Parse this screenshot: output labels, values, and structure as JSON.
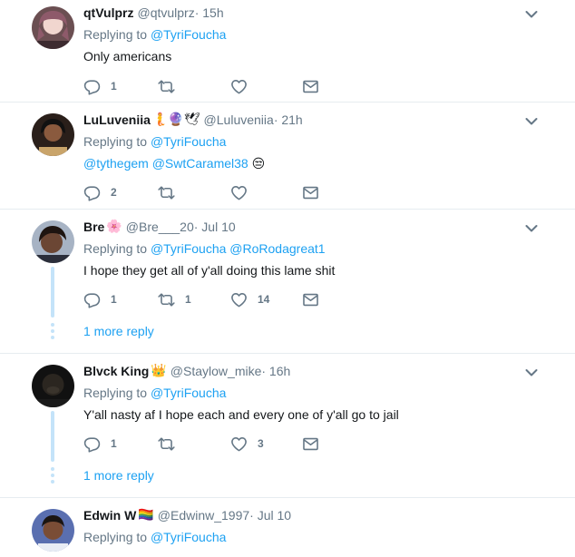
{
  "tweets": [
    {
      "name": "qtVulprz",
      "handle": "@qtvulprz",
      "time": " · 15h",
      "replying_label": "Replying to",
      "replying_to": "@TyriFoucha",
      "text": "Only americans",
      "replies": "1",
      "retweets": "",
      "likes": ""
    },
    {
      "name": "LuLuveniia",
      "name_emojis": "🧜🔮🕊",
      "handle": "@Luluveniia",
      "time": " · 21h",
      "replying_label": "Replying to",
      "replying_to": "@TyriFoucha",
      "text_mentions": "@tythegem @SwtCaramel38",
      "text_emoji": "😒",
      "replies": "2",
      "retweets": "",
      "likes": ""
    },
    {
      "name": "Bre",
      "name_emojis": "🌸",
      "handle": "@Bre___20",
      "time": " · Jul 10",
      "replying_label": "Replying to",
      "replying_to": "@TyriFoucha @RoRodagreat1",
      "text": "I hope they get all of y'all doing this lame shit",
      "replies": "1",
      "retweets": "1",
      "likes": "14",
      "more_reply": "1 more reply"
    },
    {
      "name": "Blvck King",
      "name_emojis": "👑",
      "handle": "@Staylow_mike",
      "time": " · 16h",
      "replying_label": "Replying to",
      "replying_to": "@TyriFoucha",
      "text": "Y'all nasty af I hope each and every one of y'all go to jail",
      "replies": "1",
      "retweets": "",
      "likes": "3",
      "more_reply": "1 more reply"
    },
    {
      "name": "Edwin W",
      "name_emojis": "🏳️‍🌈",
      "handle": "@Edwinw_1997",
      "time": " · Jul 10",
      "replying_label": "Replying to",
      "replying_to": "@TyriFoucha"
    }
  ],
  "icons": {
    "reply": "reply-icon",
    "retweet": "retweet-icon",
    "like": "heart-icon",
    "dm": "envelope-icon",
    "menu": "chevron-down-icon"
  },
  "colors": {
    "link": "#1da1f2",
    "secondary": "#657786",
    "divider": "#e6ecf0",
    "thread": "#c4e3f9"
  }
}
